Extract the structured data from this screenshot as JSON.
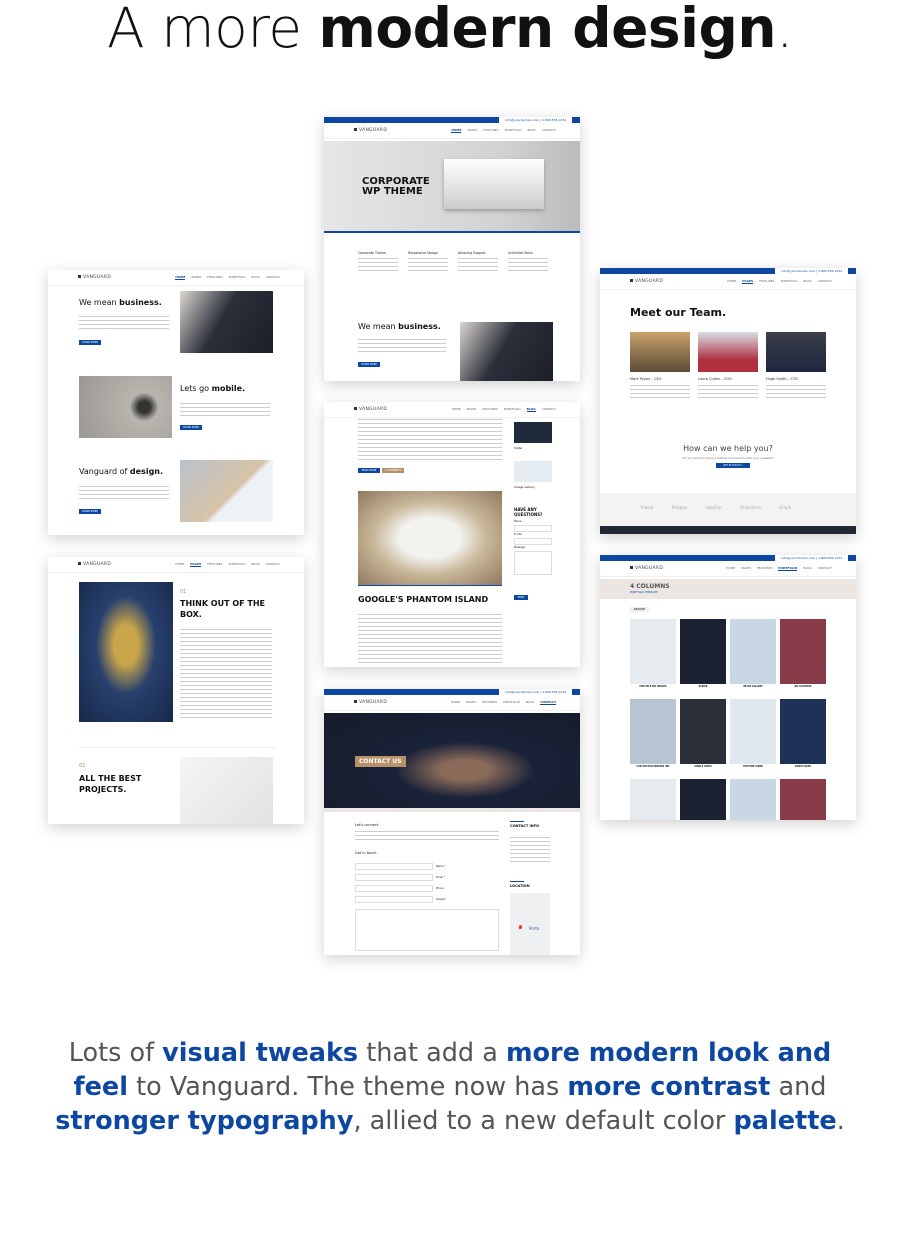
{
  "headline": {
    "pre": "A more ",
    "bold": "modern design",
    "post": "."
  },
  "brand": {
    "logo": "VANGUARD",
    "topbar": "info@yourdomain.com | 1.800.555.1234",
    "accent": "#0d47a1",
    "tan": "#b8916a"
  },
  "nav": [
    "HOME",
    "PAGES",
    "FEATURES",
    "PORTFOLIO",
    "BLOG",
    "CONTACT"
  ],
  "home": {
    "hero_title": "CORPORATE WP THEME",
    "features": [
      "Corporate Theme",
      "Responsive Design",
      "Amazing Support",
      "Unlimited Skins"
    ],
    "section_title": "We mean ",
    "section_bold": "business.",
    "button": "LEARN MORE"
  },
  "home2": {
    "s1": "We mean ",
    "s1b": "business.",
    "s2": "Lets go ",
    "s2b": "mobile.",
    "s3": "Vanguard of ",
    "s3b": "design.",
    "button": "LEARN MORE"
  },
  "team": {
    "title": "Meet our Team.",
    "members": [
      "Mark Taylor – CEO",
      "Laura Cullen – COO",
      "Hugh Smith – CTO"
    ],
    "cta_title": "How can we help you?",
    "cta_sub": "Do you want to have a lasting impression with your website?",
    "cta_button": "GET IN TOUCH »",
    "clients": [
      "Trident",
      "Polygon",
      "LoopFan",
      "Dropchess",
      "Graph"
    ]
  },
  "about": {
    "n1": "01",
    "t1": "THINK OUT OF THE BOX.",
    "n2": "02",
    "t2": "ALL THE BEST PROJECTS."
  },
  "blog": {
    "post_title": "GOOGLE'S PHANTOM ISLAND",
    "read_more": "READ MORE",
    "comments": "0 COMMENTS",
    "sidebar_title": "HAVE ANY QUESTIONS?",
    "fields": [
      "Name",
      "E-mail",
      "Message"
    ],
    "send": "SEND",
    "widgets": [
      "Slider",
      "Image Gallery"
    ]
  },
  "portfolio": {
    "title": "4 COLUMNS",
    "subtitle": "PORTFOLIO TEMPLATE",
    "filter": "BROWSE",
    "items": [
      "MULTIPLE BIG IMAGES",
      "SLIDER",
      "IMAGE GALLERY",
      "NO LIGHTBOX",
      "CUSTOM DESTINATION URL",
      "SINGLE VIDEO",
      "YOUTUBE VIDEO",
      "VIMEO VIDEO"
    ]
  },
  "contact": {
    "hero": "CONTACT US",
    "intro": "Let's connect",
    "get": "Get in touch",
    "fields": [
      "Name *",
      "Email *",
      "Phone",
      "Subject"
    ],
    "info_title": "CONTACT INFO",
    "location": "LOCATION",
    "map_label": "Porto"
  },
  "bottom": {
    "p1": "Lots of ",
    "b1": "visual tweaks",
    "p2": " that add a ",
    "b2": "more modern look and feel",
    "p3": " to Vanguard. The theme now has ",
    "b3": "more contrast",
    "p4": " and ",
    "b4": "stronger typography",
    "p5": ", allied to a new default color ",
    "b5": "palette",
    "p6": "."
  }
}
